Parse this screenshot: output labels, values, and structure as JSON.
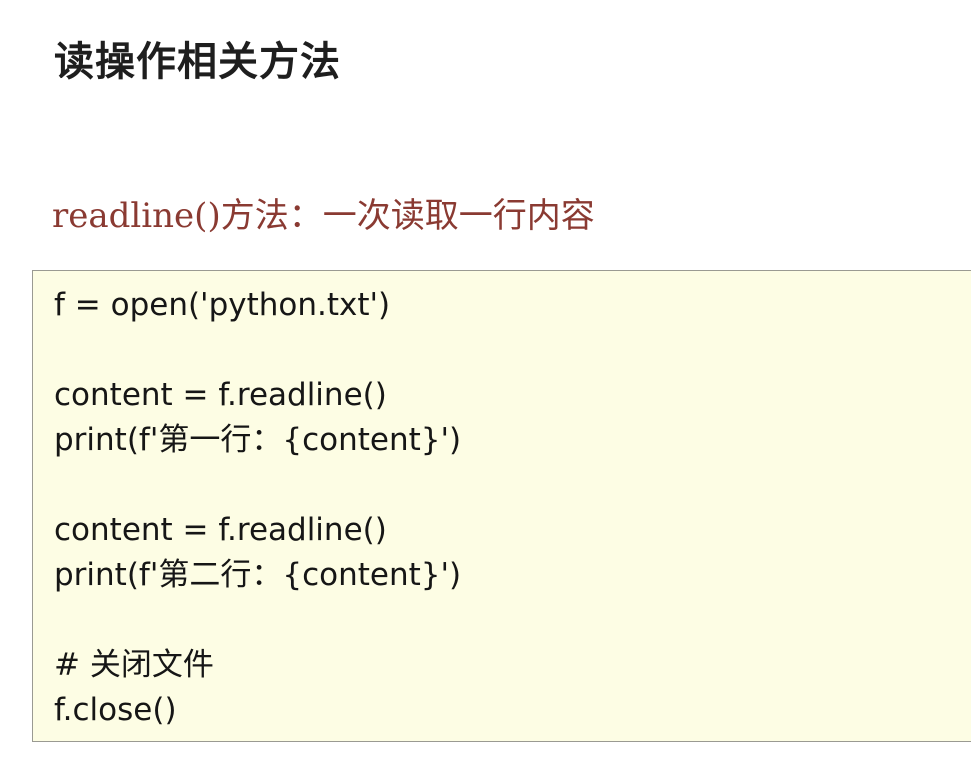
{
  "slide": {
    "title": "读操作相关方法",
    "subtitle": "readline()方法：一次读取一行内容"
  },
  "code": {
    "lines": [
      "f = open('python.txt')",
      "",
      "content = f.readline()",
      "print(f'第一行：{content}')",
      "",
      "content = f.readline()",
      "print(f'第二行：{content}')",
      "",
      "# 关闭文件",
      "f.close()"
    ]
  },
  "colors": {
    "title": "#1e1e1e",
    "subtitle": "#8a3a32",
    "code_background": "#fdfde4",
    "code_border": "#9a9a92",
    "code_text": "#161616"
  }
}
